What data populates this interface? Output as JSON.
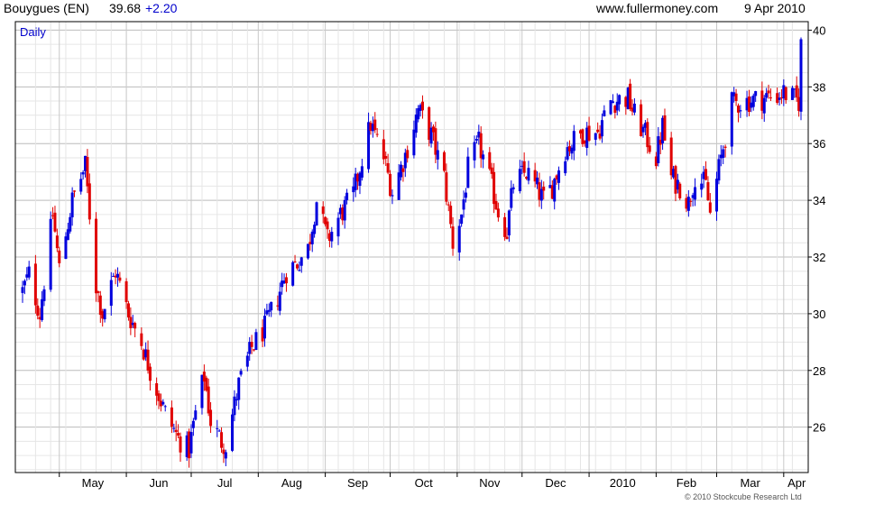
{
  "header": {
    "symbol": "Bouygues (EN)",
    "price": "39.68",
    "change": "+2.20",
    "site": "www.fullermoney.com",
    "date": "9 Apr 2010"
  },
  "footer": {
    "copyright": "© 2010 Stockcube Research Ltd"
  },
  "colors": {
    "up": "#0000dd",
    "down": "#e00000",
    "change": "#0000cc",
    "grid": "#d8d8d8",
    "frame": "#000000"
  },
  "chart_data": {
    "type": "candlestick",
    "title": "Bouygues (EN)",
    "period_label": "Daily",
    "ylim": [
      24.4,
      40.3
    ],
    "yticks": [
      26,
      28,
      30,
      32,
      34,
      36,
      38,
      40
    ],
    "month_labels": [
      "May",
      "Jun",
      "Jul",
      "Aug",
      "Sep",
      "Oct",
      "Nov",
      "Dec",
      "2010",
      "Feb",
      "Mar",
      "Apr"
    ],
    "x_start": "2009-04-14",
    "x_end": "2010-04-09",
    "grid": true,
    "control_points": [
      [
        "2009-04-14",
        30.8
      ],
      [
        "2009-04-17",
        31.4
      ],
      [
        "2009-04-22",
        30.0
      ],
      [
        "2009-04-28",
        33.5
      ],
      [
        "2009-05-01",
        31.6
      ],
      [
        "2009-05-07",
        34.0
      ],
      [
        "2009-05-13",
        35.2
      ],
      [
        "2009-05-18",
        31.0
      ],
      [
        "2009-05-21",
        30.0
      ],
      [
        "2009-05-27",
        31.5
      ],
      [
        "2009-06-02",
        30.0
      ],
      [
        "2009-06-08",
        29.0
      ],
      [
        "2009-06-12",
        28.0
      ],
      [
        "2009-06-19",
        26.5
      ],
      [
        "2009-06-25",
        25.6
      ],
      [
        "2009-06-30",
        25.2
      ],
      [
        "2009-07-03",
        26.5
      ],
      [
        "2009-07-07",
        27.8
      ],
      [
        "2009-07-10",
        26.2
      ],
      [
        "2009-07-15",
        25.5
      ],
      [
        "2009-07-17",
        25.4
      ],
      [
        "2009-07-23",
        27.5
      ],
      [
        "2009-07-29",
        28.8
      ],
      [
        "2009-08-04",
        29.5
      ],
      [
        "2009-08-10",
        30.6
      ],
      [
        "2009-08-14",
        31.5
      ],
      [
        "2009-08-19",
        31.8
      ],
      [
        "2009-08-24",
        32.3
      ],
      [
        "2009-08-28",
        34.0
      ],
      [
        "2009-09-02",
        32.6
      ],
      [
        "2009-09-08",
        33.5
      ],
      [
        "2009-09-14",
        34.2
      ],
      [
        "2009-09-18",
        35.5
      ],
      [
        "2009-09-22",
        36.7
      ],
      [
        "2009-09-28",
        35.5
      ],
      [
        "2009-10-02",
        34.3
      ],
      [
        "2009-10-08",
        35.6
      ],
      [
        "2009-10-14",
        37.2
      ],
      [
        "2009-10-20",
        36.3
      ],
      [
        "2009-10-26",
        34.8
      ],
      [
        "2009-10-30",
        32.5
      ],
      [
        "2009-11-03",
        33.5
      ],
      [
        "2009-11-06",
        35.1
      ],
      [
        "2009-11-11",
        36.0
      ],
      [
        "2009-11-17",
        34.5
      ],
      [
        "2009-11-20",
        33.6
      ],
      [
        "2009-11-24",
        32.9
      ],
      [
        "2009-11-27",
        34.6
      ],
      [
        "2009-12-03",
        35.0
      ],
      [
        "2009-12-08",
        34.4
      ],
      [
        "2009-12-11",
        34.0
      ],
      [
        "2009-12-15",
        34.5
      ],
      [
        "2009-12-21",
        35.8
      ],
      [
        "2009-12-29",
        36.4
      ],
      [
        "2010-01-05",
        36.4
      ],
      [
        "2010-01-11",
        37.5
      ],
      [
        "2010-01-19",
        37.6
      ],
      [
        "2010-01-22",
        37.0
      ],
      [
        "2010-01-27",
        36.3
      ],
      [
        "2010-02-01",
        35.5
      ],
      [
        "2010-02-04",
        36.6
      ],
      [
        "2010-02-08",
        34.8
      ],
      [
        "2010-02-12",
        34.5
      ],
      [
        "2010-02-16",
        33.9
      ],
      [
        "2010-02-19",
        34.9
      ],
      [
        "2010-02-24",
        34.5
      ],
      [
        "2010-02-26",
        33.5
      ],
      [
        "2010-03-03",
        35.5
      ],
      [
        "2010-03-08",
        37.4
      ],
      [
        "2010-03-15",
        37.5
      ],
      [
        "2010-03-22",
        37.6
      ],
      [
        "2010-03-29",
        37.7
      ],
      [
        "2010-04-01",
        37.8
      ],
      [
        "2010-04-07",
        37.5
      ],
      [
        "2010-04-08",
        37.5
      ],
      [
        "2010-04-09",
        39.68
      ]
    ]
  }
}
